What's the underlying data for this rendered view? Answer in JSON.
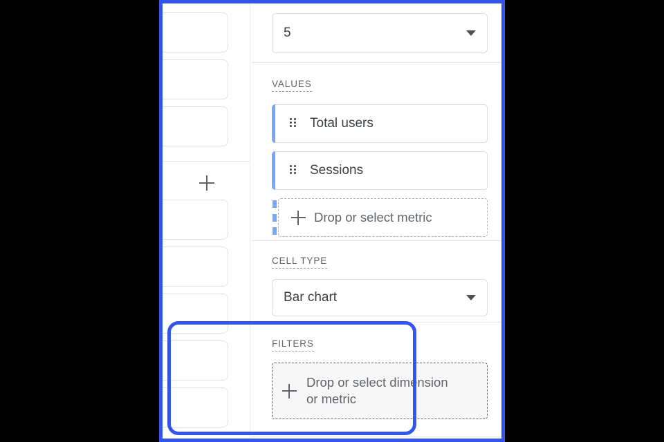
{
  "panel": {
    "name": "report-customization-panel"
  },
  "left_column": {
    "name": "cards-column",
    "cards_above": 3,
    "cards_below": 5,
    "add_button": {
      "icon": "plus-icon",
      "label": "+"
    }
  },
  "top_control": {
    "value": "5",
    "caret_icon": "chevron-down-icon"
  },
  "values_section": {
    "label": "VALUES",
    "metrics": [
      {
        "label": "Total users",
        "handle_icon": "drag-handle-icon"
      },
      {
        "label": "Sessions",
        "handle_icon": "drag-handle-icon"
      }
    ],
    "dropzone": {
      "label": "Drop or select metric",
      "icon": "plus-icon"
    }
  },
  "cell_type_section": {
    "label": "CELL TYPE",
    "value": "Bar chart",
    "caret_icon": "chevron-down-icon"
  },
  "filters_section": {
    "label": "FILTERS",
    "dropzone": {
      "line1": "Drop or select dimension",
      "line2": "or metric",
      "icon": "plus-icon"
    }
  },
  "colors": {
    "highlight_blue": "#3355ee",
    "accent_blue": "#7ba7f0",
    "text_primary": "#3c4043",
    "text_secondary": "#5f6368",
    "border": "#dadce0",
    "background": "#ffffff",
    "letterbox": "#000000"
  }
}
